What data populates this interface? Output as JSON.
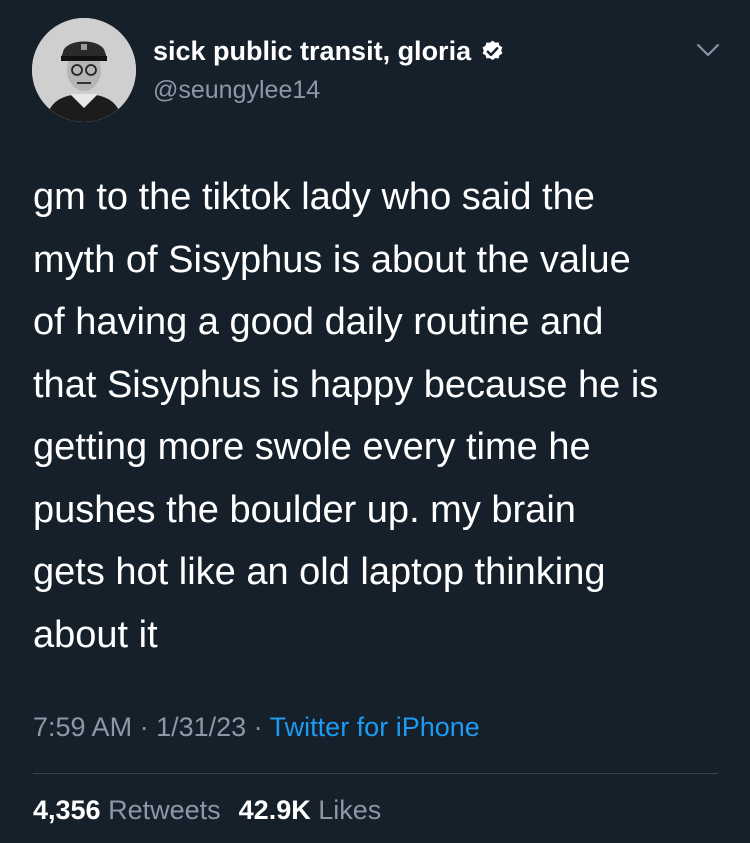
{
  "author": {
    "display_name": "sick public transit, gloria",
    "handle": "@seungylee14",
    "verified": true,
    "avatar_icon": "avatar-photo-icon"
  },
  "tweet": {
    "lines": [
      "gm to the tiktok lady who said the",
      "myth of Sisyphus is about the value",
      "of having a good daily routine and",
      "that Sisyphus is happy because he is",
      "getting more swole every time he",
      "pushes the boulder up. my brain",
      "gets hot like an old laptop thinking",
      "about it"
    ]
  },
  "meta": {
    "time": "7:59 AM",
    "sep1": " · ",
    "date": "1/31/23",
    "sep2": " · ",
    "source": "Twitter for iPhone"
  },
  "stats": {
    "retweets_count": "4,356",
    "retweets_label": "Retweets",
    "likes_count": "42.9K",
    "likes_label": "Likes"
  },
  "colors": {
    "background": "#15202b",
    "text": "#ffffff",
    "secondary": "#8b98a5",
    "link": "#1d9bf0",
    "divider": "#38444d"
  }
}
